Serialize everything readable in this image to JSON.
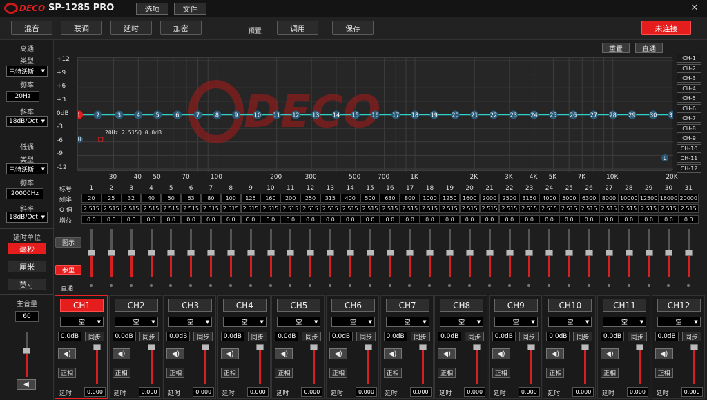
{
  "titlebar": {
    "logo_text": "DECO",
    "app_title": "SP-1285 PRO",
    "menu_options": "选项",
    "menu_file": "文件",
    "minimize": "—",
    "close": "✕"
  },
  "toolbar": {
    "mix": "混音",
    "link": "联调",
    "delay": "延时",
    "encrypt": "加密",
    "preset_label": "预置",
    "load": "调用",
    "save": "保存",
    "connect": "未连接"
  },
  "left": {
    "highpass": {
      "title": "高通",
      "type_label": "类型",
      "type_value": "巴特沃斯",
      "freq_label": "频率",
      "freq_value": "20Hz",
      "slope_label": "斜率",
      "slope_value": "18dB/Oct"
    },
    "lowpass": {
      "title": "低通",
      "type_label": "类型",
      "type_value": "巴特沃斯",
      "freq_label": "频率",
      "freq_value": "20000Hz",
      "slope_label": "斜率",
      "slope_value": "18dB/Oct"
    },
    "delay_unit": {
      "title": "延时单位",
      "ms": "毫秒",
      "cm": "厘米",
      "inch": "英寸"
    },
    "master": {
      "title": "主音量",
      "value": "60",
      "level": 0.6
    }
  },
  "graph": {
    "reset": "重置",
    "bypass": "直通",
    "y_labels": [
      "+12",
      "+9",
      "+6",
      "+3",
      "0dB",
      "-3",
      "-6",
      "-9",
      "-12"
    ],
    "x_labels": [
      "30",
      "40",
      "50",
      "70",
      "100",
      "200",
      "300",
      "500",
      "700",
      "1K",
      "2K",
      "3K",
      "4K",
      "5K",
      "7K",
      "10K",
      "20K"
    ],
    "point_info": "20Hz 2.515Q 0.0dB",
    "hp_marker": "H",
    "lp_marker": "L",
    "channels": [
      "CH-1",
      "CH-2",
      "CH-3",
      "CH-4",
      "CH-5",
      "CH-6",
      "CH-7",
      "CH-8",
      "CH-9",
      "CH-10",
      "CH-11",
      "CH-12"
    ]
  },
  "eq_table": {
    "row_labels": {
      "index": "标号",
      "freq": "频率",
      "q": "Q 值",
      "gain": "增益"
    },
    "index": [
      "1",
      "2",
      "3",
      "4",
      "5",
      "6",
      "7",
      "8",
      "9",
      "10",
      "11",
      "12",
      "13",
      "14",
      "15",
      "16",
      "17",
      "18",
      "19",
      "20",
      "21",
      "22",
      "23",
      "24",
      "25",
      "26",
      "27",
      "28",
      "29",
      "30",
      "31"
    ],
    "freq": [
      "20",
      "25",
      "32",
      "40",
      "50",
      "63",
      "80",
      "100",
      "125",
      "160",
      "200",
      "250",
      "315",
      "400",
      "500",
      "630",
      "800",
      "1000",
      "1250",
      "1600",
      "2000",
      "2500",
      "3150",
      "4000",
      "5000",
      "6300",
      "8000",
      "10000",
      "12500",
      "16000",
      "20000"
    ],
    "q": [
      "2.515",
      "2.515",
      "2.515",
      "2.515",
      "2.515",
      "2.515",
      "2.515",
      "2.515",
      "2.515",
      "2.515",
      "2.515",
      "2.515",
      "2.515",
      "2.515",
      "2.515",
      "2.515",
      "2.515",
      "2.515",
      "2.515",
      "2.515",
      "2.515",
      "2.515",
      "2.515",
      "2.515",
      "2.515",
      "2.515",
      "2.515",
      "2.515",
      "2.515",
      "2.515",
      "2.515"
    ],
    "gain": [
      "0.0",
      "0.0",
      "0.0",
      "0.0",
      "0.0",
      "0.0",
      "0.0",
      "0.0",
      "0.0",
      "0.0",
      "0.0",
      "0.0",
      "0.0",
      "0.0",
      "0.0",
      "0.0",
      "0.0",
      "0.0",
      "0.0",
      "0.0",
      "0.0",
      "0.0",
      "0.0",
      "0.0",
      "0.0",
      "0.0",
      "0.0",
      "0.0",
      "0.0",
      "0.0",
      "0.0"
    ],
    "side": {
      "show": "图示",
      "param": "参里",
      "bypass": "直通"
    }
  },
  "strips": [
    {
      "name": "CH1",
      "source": "空",
      "gain": "0.0dB",
      "sync": "同步",
      "phase": "正相",
      "delay_label": "延时",
      "delay": "0.000",
      "active": true
    },
    {
      "name": "CH2",
      "source": "空",
      "gain": "0.0dB",
      "sync": "同步",
      "phase": "正相",
      "delay_label": "延时",
      "delay": "0.000",
      "active": false
    },
    {
      "name": "CH3",
      "source": "空",
      "gain": "0.0dB",
      "sync": "同步",
      "phase": "正相",
      "delay_label": "延时",
      "delay": "0.000",
      "active": false
    },
    {
      "name": "CH4",
      "source": "空",
      "gain": "0.0dB",
      "sync": "同步",
      "phase": "正相",
      "delay_label": "延时",
      "delay": "0.000",
      "active": false
    },
    {
      "name": "CH5",
      "source": "空",
      "gain": "0.0dB",
      "sync": "同步",
      "phase": "正相",
      "delay_label": "延时",
      "delay": "0.000",
      "active": false
    },
    {
      "name": "CH6",
      "source": "空",
      "gain": "0.0dB",
      "sync": "同步",
      "phase": "正相",
      "delay_label": "延时",
      "delay": "0.000",
      "active": false
    },
    {
      "name": "CH7",
      "source": "空",
      "gain": "0.0dB",
      "sync": "同步",
      "phase": "正相",
      "delay_label": "延时",
      "delay": "0.000",
      "active": false
    },
    {
      "name": "CH8",
      "source": "空",
      "gain": "0.0dB",
      "sync": "同步",
      "phase": "正相",
      "delay_label": "延时",
      "delay": "0.000",
      "active": false
    },
    {
      "name": "CH9",
      "source": "空",
      "gain": "0.0dB",
      "sync": "同步",
      "phase": "正相",
      "delay_label": "延时",
      "delay": "0.000",
      "active": false
    },
    {
      "name": "CH10",
      "source": "空",
      "gain": "0.0dB",
      "sync": "同步",
      "phase": "正相",
      "delay_label": "延时",
      "delay": "0.000",
      "active": false
    },
    {
      "name": "CH11",
      "source": "空",
      "gain": "0.0dB",
      "sync": "同步",
      "phase": "正相",
      "delay_label": "延时",
      "delay": "0.000",
      "active": false
    },
    {
      "name": "CH12",
      "source": "空",
      "gain": "0.0dB",
      "sync": "同步",
      "phase": "正相",
      "delay_label": "延时",
      "delay": "0.000",
      "active": false
    }
  ],
  "colors": {
    "accent": "#e51d1d",
    "curve": "#2fd0c8",
    "point": "#2a5a78"
  }
}
